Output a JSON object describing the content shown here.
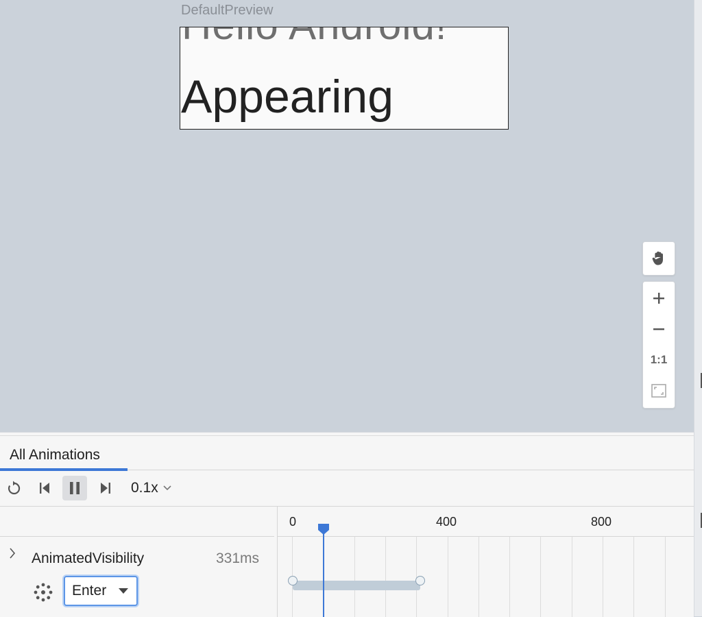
{
  "preview": {
    "title": "DefaultPreview",
    "hello_text": "Hello Android!",
    "appearing_text": "Appearing"
  },
  "zoom_controls": {
    "pan_icon": "hand-icon",
    "zoom_in_icon": "plus-icon",
    "zoom_out_icon": "minus-icon",
    "actual_size_label": "1:1",
    "fit_icon": "fit-screen-icon"
  },
  "inspector": {
    "tab_label": "All Animations",
    "controls": {
      "replay_icon": "replay-icon",
      "skip_start_icon": "skip-to-start-icon",
      "pause_icon": "pause-icon",
      "skip_end_icon": "skip-to-end-icon",
      "speed": "0.1x"
    },
    "animation": {
      "name": "AnimatedVisibility",
      "duration": "331ms",
      "state": "Enter",
      "playhead_ms": 100,
      "bar_end_ms": 415
    },
    "timeline": {
      "ticks": [
        "0",
        "400",
        "800"
      ]
    }
  },
  "colors": {
    "canvas": "#cbd2da",
    "accent": "#3d78d6",
    "panel": "#f6f6f6"
  }
}
